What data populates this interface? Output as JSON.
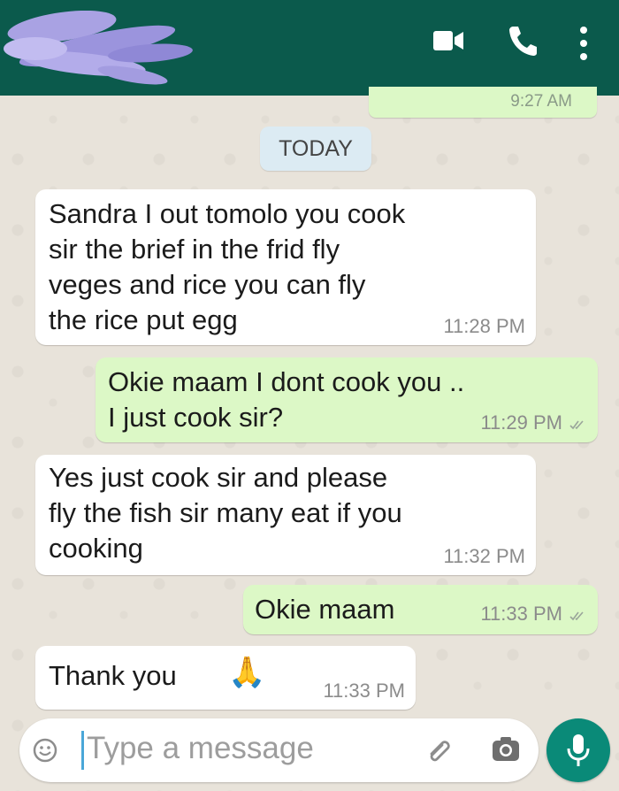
{
  "header": {
    "color": "#0b5a4c",
    "icons": [
      "video-call-icon",
      "voice-call-icon",
      "more-options-icon"
    ]
  },
  "previous_message": {
    "time": "9:27 AM"
  },
  "date_separator": "TODAY",
  "messages": [
    {
      "direction": "incoming",
      "text": "Sandra I out tomolo you cook\nsir the brief in the frid fly\nveges  and rice you can fly\nthe rice put egg",
      "time": "11:28 PM"
    },
    {
      "direction": "outgoing",
      "text": "Okie maam I dont cook you ..\nI just cook sir?",
      "time": "11:29 PM",
      "ticks": "double-check-icon"
    },
    {
      "direction": "incoming",
      "text": "Yes just cook sir and please\nfly the fish sir many eat if you\ncooking",
      "time": "11:32 PM"
    },
    {
      "direction": "outgoing",
      "text": "Okie maam",
      "time": "11:33 PM",
      "ticks": "double-check-icon"
    },
    {
      "direction": "incoming",
      "text": "Thank you",
      "emoji": "🙏",
      "time": "11:33 PM"
    }
  ],
  "composer": {
    "placeholder": "Type a message",
    "icons": [
      "emoji-icon",
      "attach-icon",
      "camera-icon",
      "mic-icon"
    ]
  },
  "colors": {
    "incoming_bubble": "#ffffff",
    "outgoing_bubble": "#dcf8c6",
    "mic_button": "#0a8a78",
    "date_chip": "#dcebf3"
  }
}
